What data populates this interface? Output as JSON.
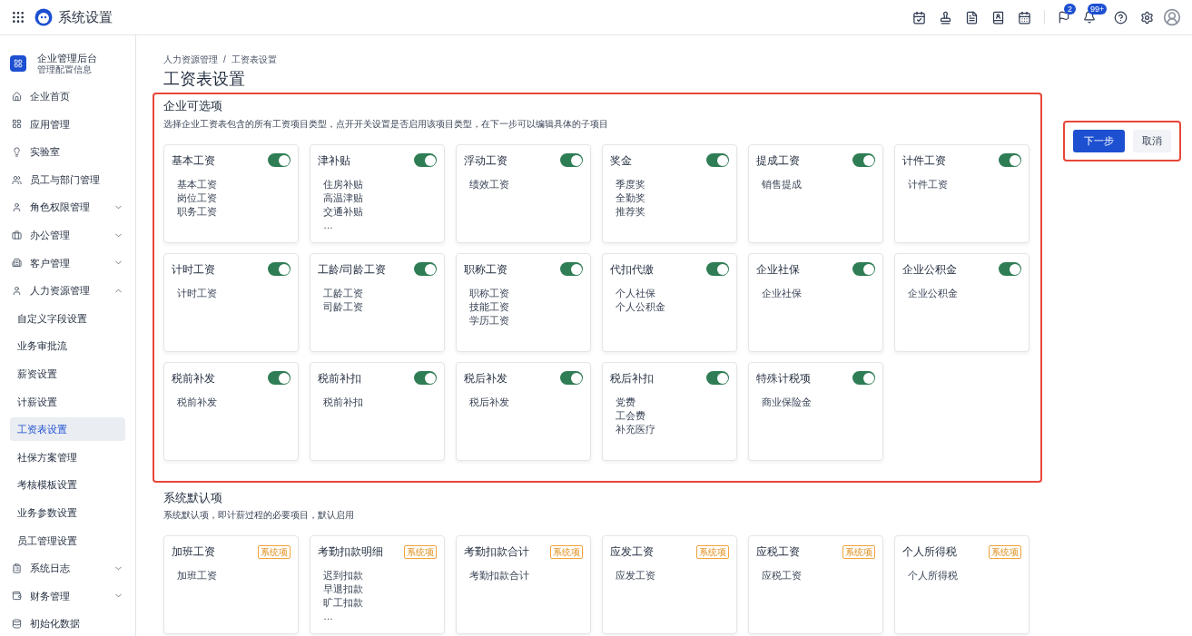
{
  "header": {
    "title": "系统设置",
    "badges": {
      "flag": "2",
      "bell": "99+"
    }
  },
  "sidebar": {
    "org": {
      "name": "企业管理后台",
      "subtitle": "管理配置信息"
    },
    "items": [
      {
        "label": "企业首页",
        "selected": false
      },
      {
        "label": "应用管理",
        "selected": false
      },
      {
        "label": "实验室",
        "selected": false
      },
      {
        "label": "员工与部门管理",
        "selected": false
      },
      {
        "label": "角色权限管理",
        "selected": false,
        "expanded": false
      },
      {
        "label": "办公管理",
        "selected": false,
        "expanded": false
      },
      {
        "label": "客户管理",
        "selected": false,
        "expanded": false
      },
      {
        "label": "人力资源管理",
        "selected": false,
        "expanded": true,
        "children": [
          {
            "label": "自定义字段设置",
            "selected": false
          },
          {
            "label": "业务审批流",
            "selected": false
          },
          {
            "label": "薪资设置",
            "selected": false
          },
          {
            "label": "计薪设置",
            "selected": false
          },
          {
            "label": "工资表设置",
            "selected": true
          },
          {
            "label": "社保方案管理",
            "selected": false
          },
          {
            "label": "考核模板设置",
            "selected": false
          },
          {
            "label": "业务参数设置",
            "selected": false
          },
          {
            "label": "员工管理设置",
            "selected": false
          }
        ]
      },
      {
        "label": "系统日志",
        "selected": false,
        "expanded": false
      },
      {
        "label": "财务管理",
        "selected": false,
        "expanded": false
      },
      {
        "label": "初始化数据",
        "selected": false
      }
    ]
  },
  "breadcrumb": [
    "人力资源管理",
    "工资表设置"
  ],
  "breadcrumb_separator": "/",
  "page_title": "工资表设置",
  "actions": {
    "next": "下一步",
    "cancel": "取消"
  },
  "optional": {
    "title": "企业可选项",
    "description": "选择企业工资表包含的所有工资项目类型，点开开关设置是否启用该项目类型，在下一步可以编辑具体的子项目",
    "cards": [
      {
        "title": "基本工资",
        "on": true,
        "items": [
          "基本工资",
          "岗位工资",
          "职务工资"
        ]
      },
      {
        "title": "津补贴",
        "on": true,
        "items": [
          "住房补贴",
          "高温津贴",
          "交通补贴",
          "…"
        ]
      },
      {
        "title": "浮动工资",
        "on": true,
        "items": [
          "绩效工资"
        ]
      },
      {
        "title": "奖金",
        "on": true,
        "items": [
          "季度奖",
          "全勤奖",
          "推荐奖"
        ]
      },
      {
        "title": "提成工资",
        "on": true,
        "items": [
          "销售提成"
        ]
      },
      {
        "title": "计件工资",
        "on": true,
        "items": [
          "计件工资"
        ]
      },
      {
        "title": "计时工资",
        "on": true,
        "items": [
          "计时工资"
        ]
      },
      {
        "title": "工龄/司龄工资",
        "on": true,
        "items": [
          "工龄工资",
          "司龄工资"
        ]
      },
      {
        "title": "职称工资",
        "on": true,
        "items": [
          "职称工资",
          "技能工资",
          "学历工资"
        ]
      },
      {
        "title": "代扣代缴",
        "on": true,
        "items": [
          "个人社保",
          "个人公积金"
        ]
      },
      {
        "title": "企业社保",
        "on": true,
        "items": [
          "企业社保"
        ]
      },
      {
        "title": "企业公积金",
        "on": true,
        "items": [
          "企业公积金"
        ]
      },
      {
        "title": "税前补发",
        "on": true,
        "items": [
          "税前补发"
        ]
      },
      {
        "title": "税前补扣",
        "on": true,
        "items": [
          "税前补扣"
        ]
      },
      {
        "title": "税后补发",
        "on": true,
        "items": [
          "税后补发"
        ]
      },
      {
        "title": "税后补扣",
        "on": true,
        "items": [
          "党费",
          "工会费",
          "补充医疗"
        ]
      },
      {
        "title": "特殊计税项",
        "on": true,
        "items": [
          "商业保险金"
        ]
      }
    ]
  },
  "system": {
    "title": "系统默认项",
    "description": "系统默认项，即计薪过程的必要项目，默认启用",
    "cards": [
      {
        "title": "加班工资",
        "badge": "系统项",
        "items": [
          "加班工资"
        ]
      },
      {
        "title": "考勤扣款明细",
        "badge": "系统项",
        "items": [
          "迟到扣款",
          "早退扣款",
          "旷工扣款",
          "…"
        ]
      },
      {
        "title": "考勤扣款合计",
        "badge": "系统项",
        "items": [
          "考勤扣款合计"
        ]
      },
      {
        "title": "应发工资",
        "badge": "系统项",
        "items": [
          "应发工资"
        ]
      },
      {
        "title": "应税工资",
        "badge": "系统项",
        "items": [
          "应税工资"
        ]
      },
      {
        "title": "个人所得税",
        "badge": "系统项",
        "items": [
          "个人所得税"
        ]
      }
    ]
  }
}
